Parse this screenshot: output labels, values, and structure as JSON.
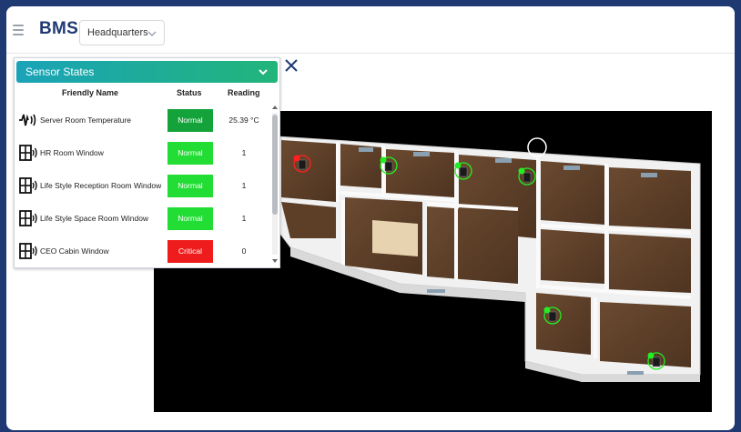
{
  "header": {
    "brand": "BMS",
    "site_selector": {
      "value": "Headquarters"
    }
  },
  "sensor_panel": {
    "title": "Sensor States",
    "columns": {
      "name": "Friendly Name",
      "status": "Status",
      "reading": "Reading"
    },
    "rows": [
      {
        "icon": "temperature-sensor-icon",
        "name": "Server Room Temperature",
        "status": "Normal",
        "status_color": "#14a33a",
        "reading": "25.39 °C"
      },
      {
        "icon": "window-sensor-icon",
        "name": "HR Room Window",
        "status": "Normal",
        "status_color": "#22dd33",
        "reading": "1"
      },
      {
        "icon": "window-sensor-icon",
        "name": "Life Style Reception Room Window",
        "status": "Normal",
        "status_color": "#22dd33",
        "reading": "1"
      },
      {
        "icon": "window-sensor-icon",
        "name": "Life Style Space Room Window",
        "status": "Normal",
        "status_color": "#22dd33",
        "reading": "1"
      },
      {
        "icon": "window-sensor-icon",
        "name": "CEO Cabin Window",
        "status": "Critical",
        "status_color": "#ee1c1c",
        "reading": "0"
      }
    ]
  },
  "floorplan": {
    "markers": [
      {
        "state": "critical",
        "color": "#ff2020"
      },
      {
        "state": "normal",
        "color": "#22ee22"
      },
      {
        "state": "normal",
        "color": "#22ee22"
      },
      {
        "state": "normal",
        "color": "#22ee22"
      },
      {
        "state": "normal",
        "color": "#22ee22"
      },
      {
        "state": "normal",
        "color": "#22ee22"
      }
    ]
  },
  "colors": {
    "frame": "#1f3a73",
    "brand": "#1f3a73",
    "header_gradient_start": "#1aa3b8",
    "header_gradient_end": "#22b57a"
  }
}
